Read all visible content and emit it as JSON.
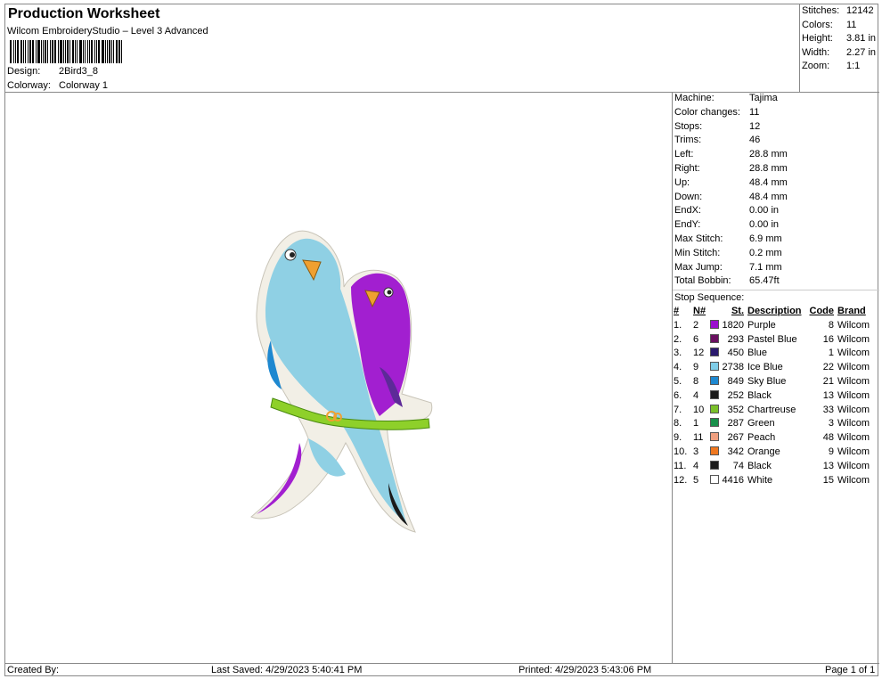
{
  "header": {
    "title": "Production Worksheet",
    "subtitle": "Wilcom EmbroideryStudio – Level 3 Advanced",
    "design_label": "Design:",
    "design_value": "2Bird3_8",
    "colorway_label": "Colorway:",
    "colorway_value": "Colorway 1"
  },
  "summary": [
    {
      "label": "Stitches:",
      "value": "12142"
    },
    {
      "label": "Colors:",
      "value": "11"
    },
    {
      "label": "Height:",
      "value": "3.81 in"
    },
    {
      "label": "Width:",
      "value": "2.27 in"
    },
    {
      "label": "Zoom:",
      "value": "1:1"
    }
  ],
  "machine_info": [
    {
      "label": "Machine:",
      "value": "Tajima"
    },
    {
      "label": "Color changes:",
      "value": "11"
    },
    {
      "label": "Stops:",
      "value": "12"
    },
    {
      "label": "Trims:",
      "value": "46"
    },
    {
      "label": "Left:",
      "value": "28.8 mm"
    },
    {
      "label": "Right:",
      "value": "28.8 mm"
    },
    {
      "label": "Up:",
      "value": "48.4 mm"
    },
    {
      "label": "Down:",
      "value": "48.4 mm"
    },
    {
      "label": "EndX:",
      "value": "0.00 in"
    },
    {
      "label": "EndY:",
      "value": "0.00 in"
    },
    {
      "label": "Max Stitch:",
      "value": "6.9 mm"
    },
    {
      "label": "Min Stitch:",
      "value": "0.2 mm"
    },
    {
      "label": "Max Jump:",
      "value": "7.1 mm"
    },
    {
      "label": "Total Bobbin:",
      "value": "65.47ft"
    }
  ],
  "stop_sequence": {
    "title": "Stop Sequence:",
    "columns": {
      "num": "#",
      "n": "N#",
      "st": "St.",
      "desc": "Description",
      "code": "Code",
      "brand": "Brand"
    },
    "rows": [
      {
        "num": "1.",
        "n": "2",
        "color": "#9b0fcf",
        "st": "1820",
        "desc": "Purple",
        "code": "8",
        "brand": "Wilcom"
      },
      {
        "num": "2.",
        "n": "6",
        "color": "#6a1060",
        "st": "293",
        "desc": "Pastel Blue",
        "code": "16",
        "brand": "Wilcom"
      },
      {
        "num": "3.",
        "n": "12",
        "color": "#2a1a6e",
        "st": "450",
        "desc": "Blue",
        "code": "1",
        "brand": "Wilcom"
      },
      {
        "num": "4.",
        "n": "9",
        "color": "#7fcde8",
        "st": "2738",
        "desc": "Ice Blue",
        "code": "22",
        "brand": "Wilcom"
      },
      {
        "num": "5.",
        "n": "8",
        "color": "#1e88d0",
        "st": "849",
        "desc": "Sky Blue",
        "code": "21",
        "brand": "Wilcom"
      },
      {
        "num": "6.",
        "n": "4",
        "color": "#1a1a1a",
        "st": "252",
        "desc": "Black",
        "code": "13",
        "brand": "Wilcom"
      },
      {
        "num": "7.",
        "n": "10",
        "color": "#7ac02a",
        "st": "352",
        "desc": "Chartreuse",
        "code": "33",
        "brand": "Wilcom"
      },
      {
        "num": "8.",
        "n": "1",
        "color": "#18904a",
        "st": "287",
        "desc": "Green",
        "code": "3",
        "brand": "Wilcom"
      },
      {
        "num": "9.",
        "n": "11",
        "color": "#f0a080",
        "st": "267",
        "desc": "Peach",
        "code": "48",
        "brand": "Wilcom"
      },
      {
        "num": "10.",
        "n": "3",
        "color": "#f07820",
        "st": "342",
        "desc": "Orange",
        "code": "9",
        "brand": "Wilcom"
      },
      {
        "num": "11.",
        "n": "4",
        "color": "#1a1a1a",
        "st": "74",
        "desc": "Black",
        "code": "13",
        "brand": "Wilcom"
      },
      {
        "num": "12.",
        "n": "5",
        "color": "#ffffff",
        "st": "4416",
        "desc": "White",
        "code": "15",
        "brand": "Wilcom"
      }
    ]
  },
  "footer": {
    "created_by": "Created By:",
    "last_saved": "Last Saved: 4/29/2023 5:40:41 PM",
    "printed": "Printed: 4/29/2023 5:43:06 PM",
    "page": "Page 1 of 1"
  },
  "colors": {
    "bird_blue": "#8fd0e4",
    "bird_purple": "#a21fd0",
    "branch": "#8ed02a",
    "beak": "#f0a030",
    "outline": "#f2efe6"
  }
}
